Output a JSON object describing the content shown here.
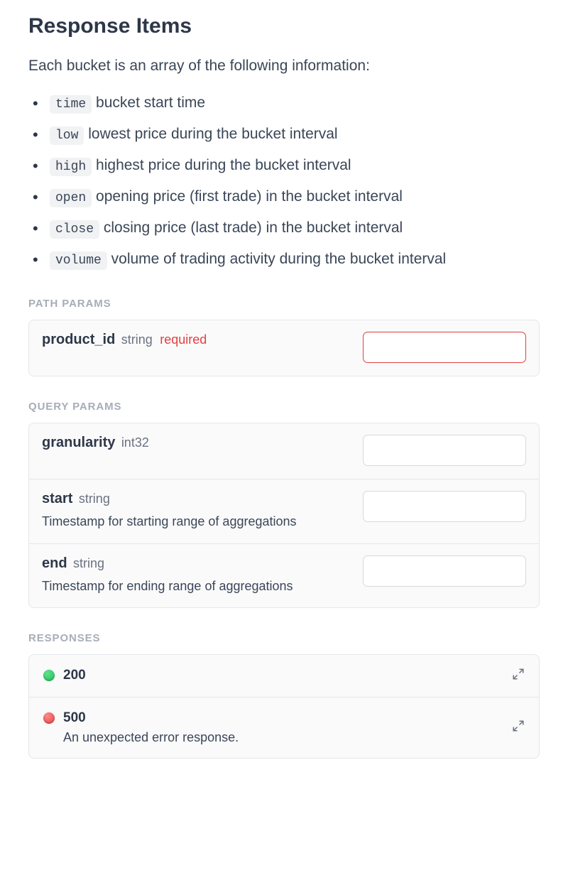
{
  "title": "Response Items",
  "intro": "Each bucket is an array of the following information:",
  "bullets": [
    {
      "code": "time",
      "text": " bucket start time"
    },
    {
      "code": "low",
      "text": " lowest price during the bucket interval"
    },
    {
      "code": "high",
      "text": " highest price during the bucket interval"
    },
    {
      "code": "open",
      "text": " opening price (first trade) in the bucket interval"
    },
    {
      "code": "close",
      "text": " closing price (last trade) in the bucket interval"
    },
    {
      "code": "volume",
      "text": " volume of trading activity during the bucket interval"
    }
  ],
  "sections": {
    "path_params_label": "PATH PARAMS",
    "query_params_label": "QUERY PARAMS",
    "responses_label": "RESPONSES"
  },
  "path_params": [
    {
      "name": "product_id",
      "type": "string",
      "required_label": "required",
      "required": true,
      "desc": "",
      "value": ""
    }
  ],
  "query_params": [
    {
      "name": "granularity",
      "type": "int32",
      "required": false,
      "desc": "",
      "value": ""
    },
    {
      "name": "start",
      "type": "string",
      "required": false,
      "desc": "Timestamp for starting range of aggregations",
      "value": ""
    },
    {
      "name": "end",
      "type": "string",
      "required": false,
      "desc": "Timestamp for ending range of aggregations",
      "value": ""
    }
  ],
  "responses": [
    {
      "code": "200",
      "status": "success",
      "desc": ""
    },
    {
      "code": "500",
      "status": "error",
      "desc": "An unexpected error response."
    }
  ]
}
